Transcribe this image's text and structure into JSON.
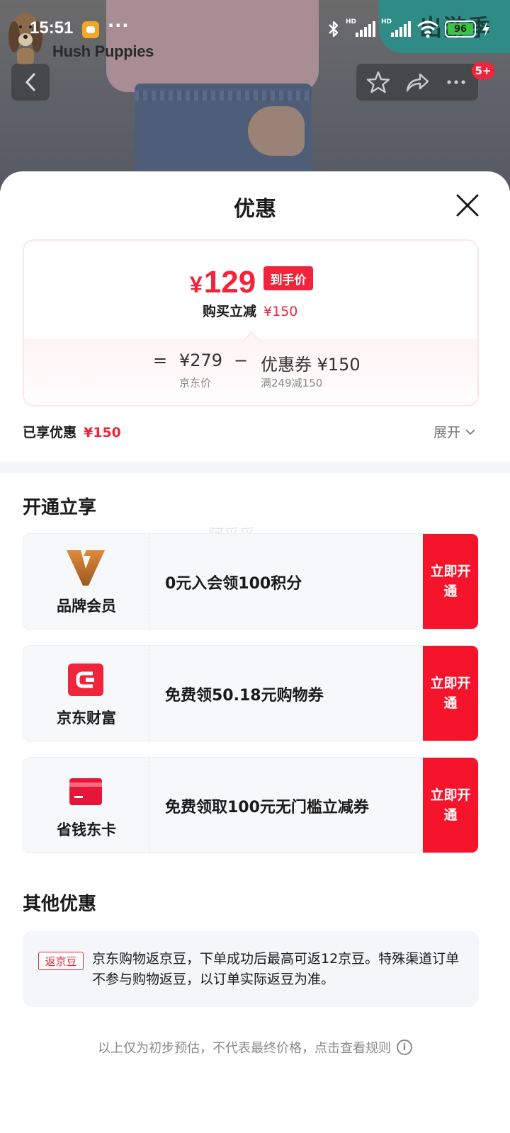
{
  "status_bar": {
    "time": "15:51",
    "dots": "···",
    "battery": "96",
    "hd1": "HD",
    "hd2": "HD"
  },
  "background": {
    "brand_logo": "Hush Puppies",
    "banner_text": "出游季",
    "notification_badge": "5+"
  },
  "sheet": {
    "title": "优惠",
    "final_price_yen": "¥",
    "final_price": "129",
    "final_price_tag": "到手价",
    "reduce_label": "购买立减",
    "reduce_value": "¥150",
    "formula": {
      "equals": "=",
      "jd_price": "¥279",
      "jd_price_label": "京东价",
      "minus": "−",
      "coupon": "优惠券 ¥150",
      "coupon_rule": "满249减150"
    },
    "enjoyed_label": "已享优惠",
    "enjoyed_value": "¥150",
    "expand_label": "展开"
  },
  "open_section": {
    "title": "开通立享",
    "watermark": "阿妥妥",
    "cards": [
      {
        "name": "品牌会员",
        "desc": "0元入会领100积分",
        "button": "立即开通",
        "icon": "brand-member-v-icon",
        "color": "#c9782f"
      },
      {
        "name": "京东财富",
        "desc": "免费领50.18元购物券",
        "button": "立即开通",
        "icon": "jd-wealth-icon",
        "color": "#f0243a"
      },
      {
        "name": "省钱东卡",
        "desc": "免费领取100元无门槛立减券",
        "button": "立即开通",
        "icon": "card-icon",
        "color": "#e5163a"
      }
    ]
  },
  "other_section": {
    "title": "其他优惠",
    "tag": "返京豆",
    "text": "京东购物返京豆，下单成功后最高可返12京豆。特殊渠道订单不参与购物返豆，以订单实际返豆为准。"
  },
  "footnote": "以上仅为初步预估，不代表最终价格，点击查看规则",
  "colors": {
    "accent_red": "#f0243a",
    "button_red": "#f5142c"
  }
}
